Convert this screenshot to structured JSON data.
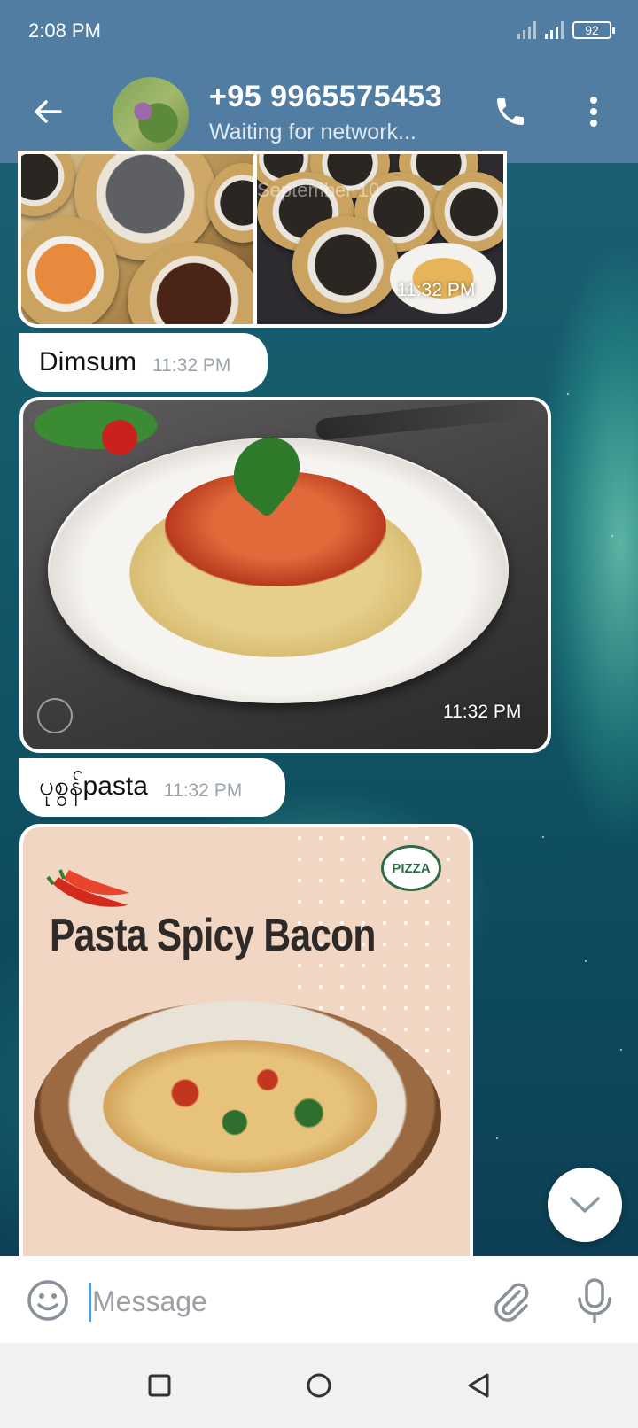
{
  "status_bar": {
    "time": "2:08 PM",
    "battery": "92"
  },
  "header": {
    "contact_name": "+95 9965575453",
    "contact_status": "Waiting for network..."
  },
  "messages": [
    {
      "type": "photo",
      "content": "dimsum-collage",
      "overlay_text": "September 10",
      "time": "11:32 PM"
    },
    {
      "type": "text",
      "text": "Dimsum",
      "time": "11:32 PM"
    },
    {
      "type": "photo",
      "content": "pasta-dish",
      "time": "11:32 PM"
    },
    {
      "type": "text",
      "text": "ပုစွန်pasta",
      "time": "11:32 PM"
    },
    {
      "type": "photo",
      "content": "pasta-promo",
      "promo_title": "Pasta Spicy Bacon",
      "logo_text": "PIZZA"
    }
  ],
  "input": {
    "placeholder": "Message"
  },
  "colors": {
    "header": "#527da3",
    "bubble": "#ffffff",
    "accent": "#5b9bd5"
  },
  "icons": [
    "back-arrow-icon",
    "phone-icon",
    "more-vert-icon",
    "emoji-icon",
    "attach-icon",
    "mic-icon",
    "chevron-down-icon",
    "nav-recents-icon",
    "nav-home-icon",
    "nav-back-icon"
  ]
}
